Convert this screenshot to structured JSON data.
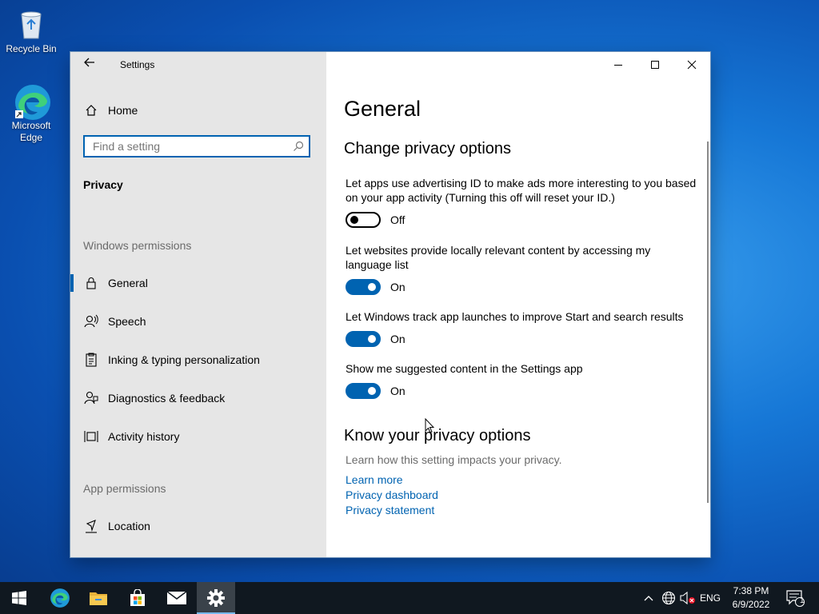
{
  "desktop": {
    "icons": [
      {
        "label": "Recycle Bin",
        "icon": "recycle-bin-icon"
      },
      {
        "label": "Microsoft\nEdge",
        "label_line1": "Microsoft",
        "label_line2": "Edge",
        "icon": "edge-icon"
      }
    ]
  },
  "window": {
    "title": "Settings",
    "controls": {
      "minimize": "minimize-icon",
      "maximize": "maximize-icon",
      "close": "close-icon"
    }
  },
  "nav": {
    "home_label": "Home",
    "search_placeholder": "Find a setting",
    "section_header": "Privacy",
    "windows_permissions_label": "Windows permissions",
    "items": [
      {
        "label": "General",
        "icon": "lock-icon",
        "selected": true
      },
      {
        "label": "Speech",
        "icon": "speech-icon"
      },
      {
        "label": "Inking & typing personalization",
        "icon": "inking-icon"
      },
      {
        "label": "Diagnostics & feedback",
        "icon": "diagnostics-icon"
      },
      {
        "label": "Activity history",
        "icon": "activity-history-icon"
      }
    ],
    "app_permissions_label": "App permissions",
    "app_items": [
      {
        "label": "Location",
        "icon": "location-icon"
      }
    ]
  },
  "main": {
    "title": "General",
    "section1_title": "Change privacy options",
    "settings": [
      {
        "description": "Let apps use advertising ID to make ads more interesting to you based on your app activity (Turning this off will reset your ID.)",
        "state": "Off",
        "on": false
      },
      {
        "description": "Let websites provide locally relevant content by accessing my language list",
        "state": "On",
        "on": true
      },
      {
        "description": "Let Windows track app launches to improve Start and search results",
        "state": "On",
        "on": true
      },
      {
        "description": "Show me suggested content in the Settings app",
        "state": "On",
        "on": true
      }
    ],
    "section2_title": "Know your privacy options",
    "section2_desc": "Learn how this setting impacts your privacy.",
    "links": [
      "Learn more",
      "Privacy dashboard",
      "Privacy statement"
    ]
  },
  "taskbar": {
    "apps": [
      "start-icon",
      "edge-icon",
      "file-explorer-icon",
      "store-icon",
      "mail-icon",
      "settings-icon"
    ],
    "language": "ENG",
    "time": "7:38 PM",
    "date": "6/9/2022",
    "notification_count": "1"
  },
  "colors": {
    "accent": "#0063b1",
    "nav_background": "#e6e6e6",
    "taskbar": "#101820"
  }
}
